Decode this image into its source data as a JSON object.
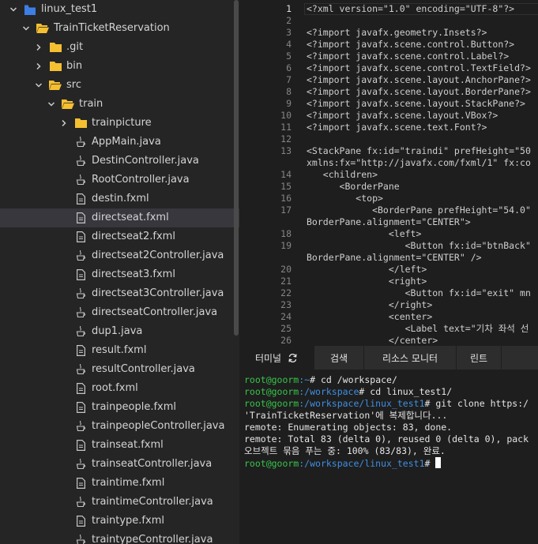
{
  "explorer": {
    "items": [
      {
        "label": "linux_test1",
        "type": "workspace",
        "chevron": "down"
      },
      {
        "label": "TrainTicketReservation",
        "type": "folder-open",
        "chevron": "down"
      },
      {
        "label": ".git",
        "type": "folder",
        "chevron": "right"
      },
      {
        "label": "bin",
        "type": "folder",
        "chevron": "right"
      },
      {
        "label": "src",
        "type": "folder-open",
        "chevron": "down"
      },
      {
        "label": "train",
        "type": "folder-open",
        "chevron": "down"
      },
      {
        "label": "trainpicture",
        "type": "folder",
        "chevron": "right"
      },
      {
        "label": "AppMain.java",
        "type": "java",
        "chevron": ""
      },
      {
        "label": "DestinController.java",
        "type": "java",
        "chevron": ""
      },
      {
        "label": "RootController.java",
        "type": "java",
        "chevron": ""
      },
      {
        "label": "destin.fxml",
        "type": "file",
        "chevron": ""
      },
      {
        "label": "directseat.fxml",
        "type": "file",
        "chevron": "",
        "selected": true
      },
      {
        "label": "directseat2.fxml",
        "type": "file",
        "chevron": ""
      },
      {
        "label": "directseat2Controller.java",
        "type": "java",
        "chevron": ""
      },
      {
        "label": "directseat3.fxml",
        "type": "file",
        "chevron": ""
      },
      {
        "label": "directseat3Controller.java",
        "type": "java",
        "chevron": ""
      },
      {
        "label": "directseatController.java",
        "type": "java",
        "chevron": ""
      },
      {
        "label": "dup1.java",
        "type": "java",
        "chevron": ""
      },
      {
        "label": "result.fxml",
        "type": "file",
        "chevron": ""
      },
      {
        "label": "resultController.java",
        "type": "java",
        "chevron": ""
      },
      {
        "label": "root.fxml",
        "type": "file",
        "chevron": ""
      },
      {
        "label": "trainpeople.fxml",
        "type": "file",
        "chevron": ""
      },
      {
        "label": "trainpeopleController.java",
        "type": "java",
        "chevron": ""
      },
      {
        "label": "trainseat.fxml",
        "type": "file",
        "chevron": ""
      },
      {
        "label": "trainseatController.java",
        "type": "java",
        "chevron": ""
      },
      {
        "label": "traintime.fxml",
        "type": "file",
        "chevron": ""
      },
      {
        "label": "traintimeController.java",
        "type": "java",
        "chevron": ""
      },
      {
        "label": "traintype.fxml",
        "type": "file",
        "chevron": ""
      },
      {
        "label": "traintypeController.java",
        "type": "java",
        "chevron": ""
      }
    ]
  },
  "editor": {
    "lines": [
      {
        "num": "1",
        "text": "<?xml version=\"1.0\" encoding=\"UTF-8\"?>",
        "active": true
      },
      {
        "num": "2",
        "text": ""
      },
      {
        "num": "3",
        "text": "<?import javafx.geometry.Insets?>"
      },
      {
        "num": "4",
        "text": "<?import javafx.scene.control.Button?>"
      },
      {
        "num": "5",
        "text": "<?import javafx.scene.control.Label?>"
      },
      {
        "num": "6",
        "text": "<?import javafx.scene.control.TextField?>"
      },
      {
        "num": "7",
        "text": "<?import javafx.scene.layout.AnchorPane?>"
      },
      {
        "num": "8",
        "text": "<?import javafx.scene.layout.BorderPane?>"
      },
      {
        "num": "9",
        "text": "<?import javafx.scene.layout.StackPane?>"
      },
      {
        "num": "10",
        "text": "<?import javafx.scene.layout.VBox?>"
      },
      {
        "num": "11",
        "text": "<?import javafx.scene.text.Font?>"
      },
      {
        "num": "12",
        "text": ""
      },
      {
        "num": "13",
        "text": "<StackPane fx:id=\"traindi\" prefHeight=\"50"
      },
      {
        "num": "",
        "text": "xmlns:fx=\"http://javafx.com/fxml/1\" fx:co"
      },
      {
        "num": "14",
        "text": "   <children>"
      },
      {
        "num": "15",
        "text": "      <BorderPane"
      },
      {
        "num": "16",
        "text": "         <top>"
      },
      {
        "num": "17",
        "text": "            <BorderPane prefHeight=\"54.0\""
      },
      {
        "num": "",
        "text": "BorderPane.alignment=\"CENTER\">"
      },
      {
        "num": "18",
        "text": "               <left>"
      },
      {
        "num": "19",
        "text": "                  <Button fx:id=\"btnBack\""
      },
      {
        "num": "",
        "text": "BorderPane.alignment=\"CENTER\" />"
      },
      {
        "num": "20",
        "text": "               </left>"
      },
      {
        "num": "21",
        "text": "               <right>"
      },
      {
        "num": "22",
        "text": "                  <Button fx:id=\"exit\" mn"
      },
      {
        "num": "23",
        "text": "               </right>"
      },
      {
        "num": "24",
        "text": "               <center>"
      },
      {
        "num": "25",
        "text": "                  <Label text=\"기차 좌석 선"
      },
      {
        "num": "26",
        "text": "               </center>"
      }
    ]
  },
  "panel": {
    "tabs": [
      {
        "label": "터미널",
        "active": true,
        "icon": "refresh-icon"
      },
      {
        "label": "검색",
        "active": false
      },
      {
        "label": "리소스 모니터",
        "active": false
      },
      {
        "label": "린트",
        "active": false
      }
    ]
  },
  "terminal": {
    "lines": [
      {
        "user": "root@goorm",
        "path": ":~",
        "cmd": "# cd /workspace/"
      },
      {
        "user": "root@goorm",
        "path": ":/workspace",
        "cmd": "# cd linux_test1/"
      },
      {
        "user": "root@goorm",
        "path": ":/workspace/linux_test1",
        "cmd": "# git clone https:/"
      },
      {
        "text": "'TrainTicketReservation'에 복제합니다..."
      },
      {
        "text": "remote: Enumerating objects: 83, done."
      },
      {
        "text": "remote: Total 83 (delta 0), reused 0 (delta 0), pack"
      },
      {
        "text": "오브젝트 묶음 푸는 중: 100% (83/83), 완료."
      },
      {
        "user": "root@goorm",
        "path": ":/workspace/linux_test1",
        "cmd": "# ",
        "caret": true
      }
    ]
  },
  "colors": {
    "folder": "#f4bf31",
    "workspace": "#3d7fe6",
    "prompt_user": "#37c44a",
    "prompt_path": "#3f8fe0",
    "selected_row": "#37373d"
  }
}
